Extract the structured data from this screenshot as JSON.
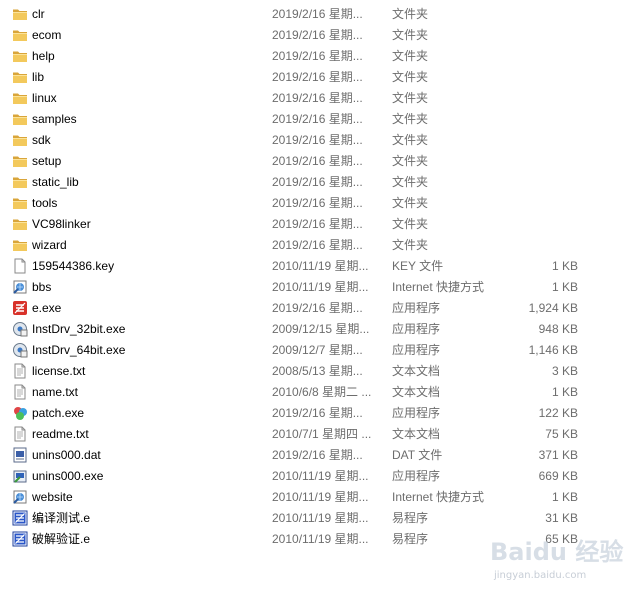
{
  "files": [
    {
      "name": "clr",
      "date": "2019/2/16 星期...",
      "type": "文件夹",
      "size": "",
      "icon": "folder-icon"
    },
    {
      "name": "ecom",
      "date": "2019/2/16 星期...",
      "type": "文件夹",
      "size": "",
      "icon": "folder-icon"
    },
    {
      "name": "help",
      "date": "2019/2/16 星期...",
      "type": "文件夹",
      "size": "",
      "icon": "folder-icon"
    },
    {
      "name": "lib",
      "date": "2019/2/16 星期...",
      "type": "文件夹",
      "size": "",
      "icon": "folder-icon"
    },
    {
      "name": "linux",
      "date": "2019/2/16 星期...",
      "type": "文件夹",
      "size": "",
      "icon": "folder-icon"
    },
    {
      "name": "samples",
      "date": "2019/2/16 星期...",
      "type": "文件夹",
      "size": "",
      "icon": "folder-icon"
    },
    {
      "name": "sdk",
      "date": "2019/2/16 星期...",
      "type": "文件夹",
      "size": "",
      "icon": "folder-icon"
    },
    {
      "name": "setup",
      "date": "2019/2/16 星期...",
      "type": "文件夹",
      "size": "",
      "icon": "folder-icon"
    },
    {
      "name": "static_lib",
      "date": "2019/2/16 星期...",
      "type": "文件夹",
      "size": "",
      "icon": "folder-icon"
    },
    {
      "name": "tools",
      "date": "2019/2/16 星期...",
      "type": "文件夹",
      "size": "",
      "icon": "folder-icon"
    },
    {
      "name": "VC98linker",
      "date": "2019/2/16 星期...",
      "type": "文件夹",
      "size": "",
      "icon": "folder-icon"
    },
    {
      "name": "wizard",
      "date": "2019/2/16 星期...",
      "type": "文件夹",
      "size": "",
      "icon": "folder-icon"
    },
    {
      "name": "159544386.key",
      "date": "2010/11/19 星期...",
      "type": "KEY 文件",
      "size": "1 KB",
      "icon": "blank-file-icon"
    },
    {
      "name": "bbs",
      "date": "2010/11/19 星期...",
      "type": "Internet 快捷方式",
      "size": "1 KB",
      "icon": "internet-shortcut-icon"
    },
    {
      "name": "e.exe",
      "date": "2019/2/16 星期...",
      "type": "应用程序",
      "size": "1,924 KB",
      "icon": "e-exe-icon"
    },
    {
      "name": "InstDrv_32bit.exe",
      "date": "2009/12/15 星期...",
      "type": "应用程序",
      "size": "948 KB",
      "icon": "installer-icon"
    },
    {
      "name": "InstDrv_64bit.exe",
      "date": "2009/12/7 星期...",
      "type": "应用程序",
      "size": "1,146 KB",
      "icon": "installer-icon"
    },
    {
      "name": "license.txt",
      "date": "2008/5/13 星期...",
      "type": "文本文档",
      "size": "3 KB",
      "icon": "text-file-icon"
    },
    {
      "name": "name.txt",
      "date": "2010/6/8 星期二 ...",
      "type": "文本文档",
      "size": "1 KB",
      "icon": "text-file-icon"
    },
    {
      "name": "patch.exe",
      "date": "2019/2/16 星期...",
      "type": "应用程序",
      "size": "122 KB",
      "icon": "patch-icon"
    },
    {
      "name": "readme.txt",
      "date": "2010/7/1 星期四 ...",
      "type": "文本文档",
      "size": "75 KB",
      "icon": "text-file-icon"
    },
    {
      "name": "unins000.dat",
      "date": "2019/2/16 星期...",
      "type": "DAT 文件",
      "size": "371 KB",
      "icon": "dat-file-icon"
    },
    {
      "name": "unins000.exe",
      "date": "2010/11/19 星期...",
      "type": "应用程序",
      "size": "669 KB",
      "icon": "uninstaller-icon"
    },
    {
      "name": "website",
      "date": "2010/11/19 星期...",
      "type": "Internet 快捷方式",
      "size": "1 KB",
      "icon": "internet-shortcut-icon"
    },
    {
      "name": "编译测试.e",
      "date": "2010/11/19 星期...",
      "type": "易程序",
      "size": "31 KB",
      "icon": "e-source-icon"
    },
    {
      "name": "破解验证.e",
      "date": "2010/11/19 星期...",
      "type": "易程序",
      "size": "65 KB",
      "icon": "e-source-icon"
    }
  ],
  "watermark": {
    "logo": "Baidu 经验",
    "url": "jingyan.baidu.com"
  },
  "colors": {
    "folder": "#e8b84a",
    "hover": "#e5f3fb",
    "secondary_text": "#6d6d6d"
  }
}
